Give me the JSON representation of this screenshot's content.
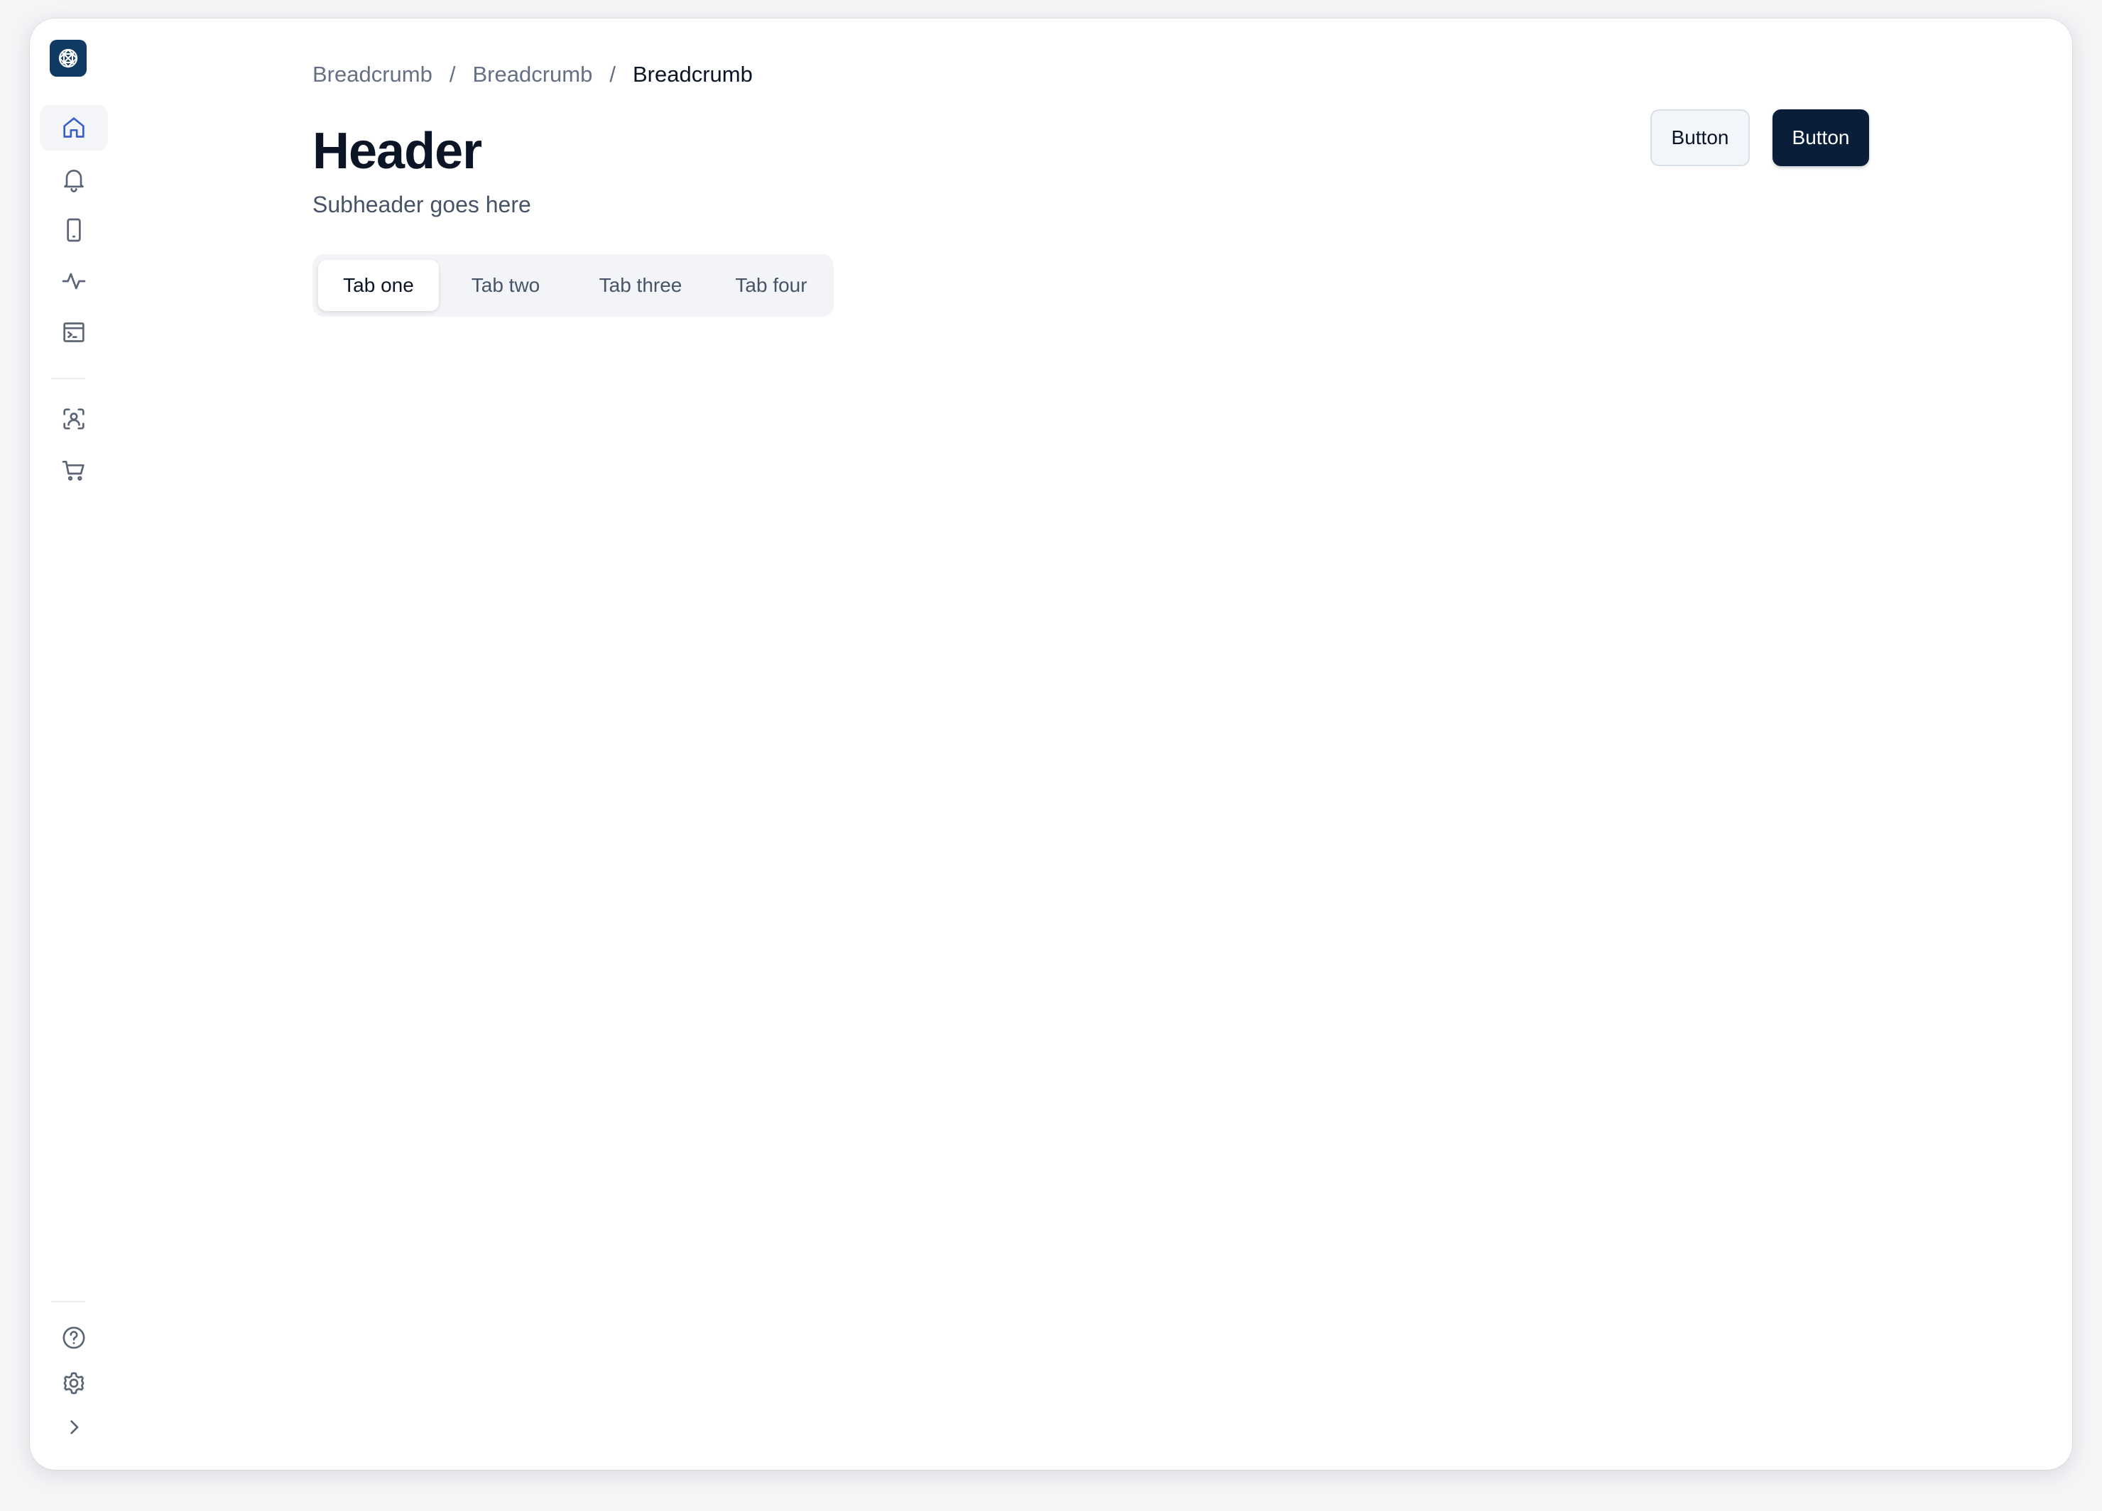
{
  "breadcrumb": {
    "items": [
      "Breadcrumb",
      "Breadcrumb",
      "Breadcrumb"
    ],
    "separator": "/"
  },
  "header": {
    "title": "Header",
    "subtitle": "Subheader goes here"
  },
  "actions": {
    "secondary_label": "Button",
    "primary_label": "Button"
  },
  "tabs": [
    {
      "label": "Tab one",
      "active": true
    },
    {
      "label": "Tab two",
      "active": false
    },
    {
      "label": "Tab three",
      "active": false
    },
    {
      "label": "Tab four",
      "active": false
    }
  ],
  "sidebar": {
    "top_items": [
      "home-icon",
      "bell-icon",
      "phone-icon",
      "activity-icon",
      "terminal-window-icon"
    ],
    "middle_items": [
      "user-scan-icon",
      "cart-icon"
    ],
    "bottom_items": [
      "help-icon",
      "gear-icon",
      "chevron-right-icon"
    ],
    "active_item": "home-icon"
  },
  "colors": {
    "brand": "#0f3a63",
    "primary_button": "#0a1e3a",
    "active_icon": "#3b5fc4",
    "text_primary": "#0b1526",
    "text_muted": "#667085"
  }
}
